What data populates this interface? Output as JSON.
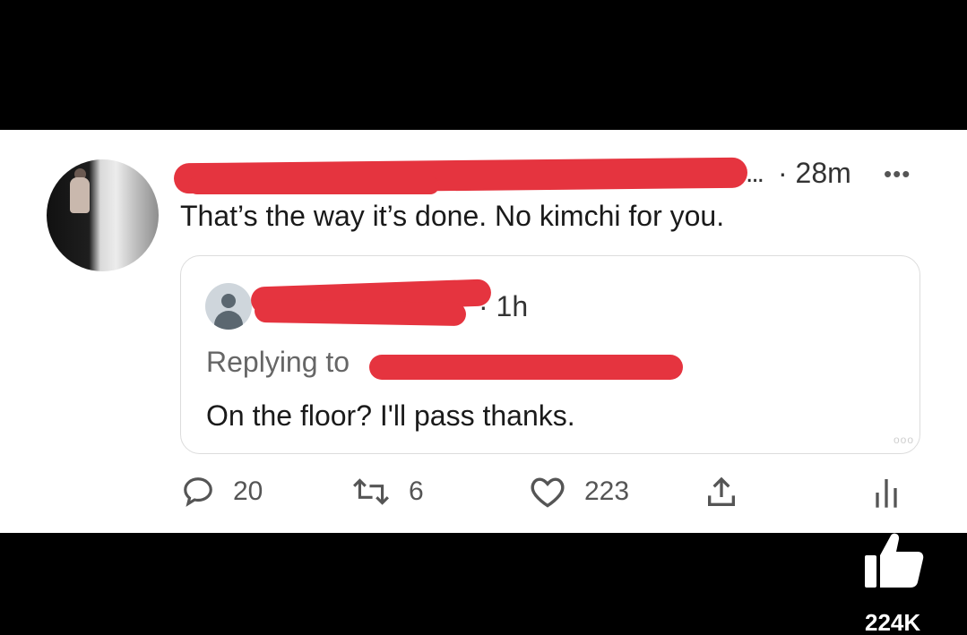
{
  "post": {
    "timestamp": "28m",
    "ellipsis": "...",
    "separator": "·",
    "more": "•••",
    "text": "That’s the way it’s done. No kimchi for you."
  },
  "quote": {
    "timestamp": "· 1h",
    "replying_prefix": "Replying to",
    "text": "On the floor? I'll pass thanks.",
    "more": "ooo"
  },
  "actions": {
    "replies": "20",
    "retweets": "6",
    "likes": "223"
  },
  "overlay": {
    "like_count": "224K"
  },
  "colors": {
    "redaction": "#e5343f",
    "background": "#000000",
    "card": "#ffffff"
  }
}
